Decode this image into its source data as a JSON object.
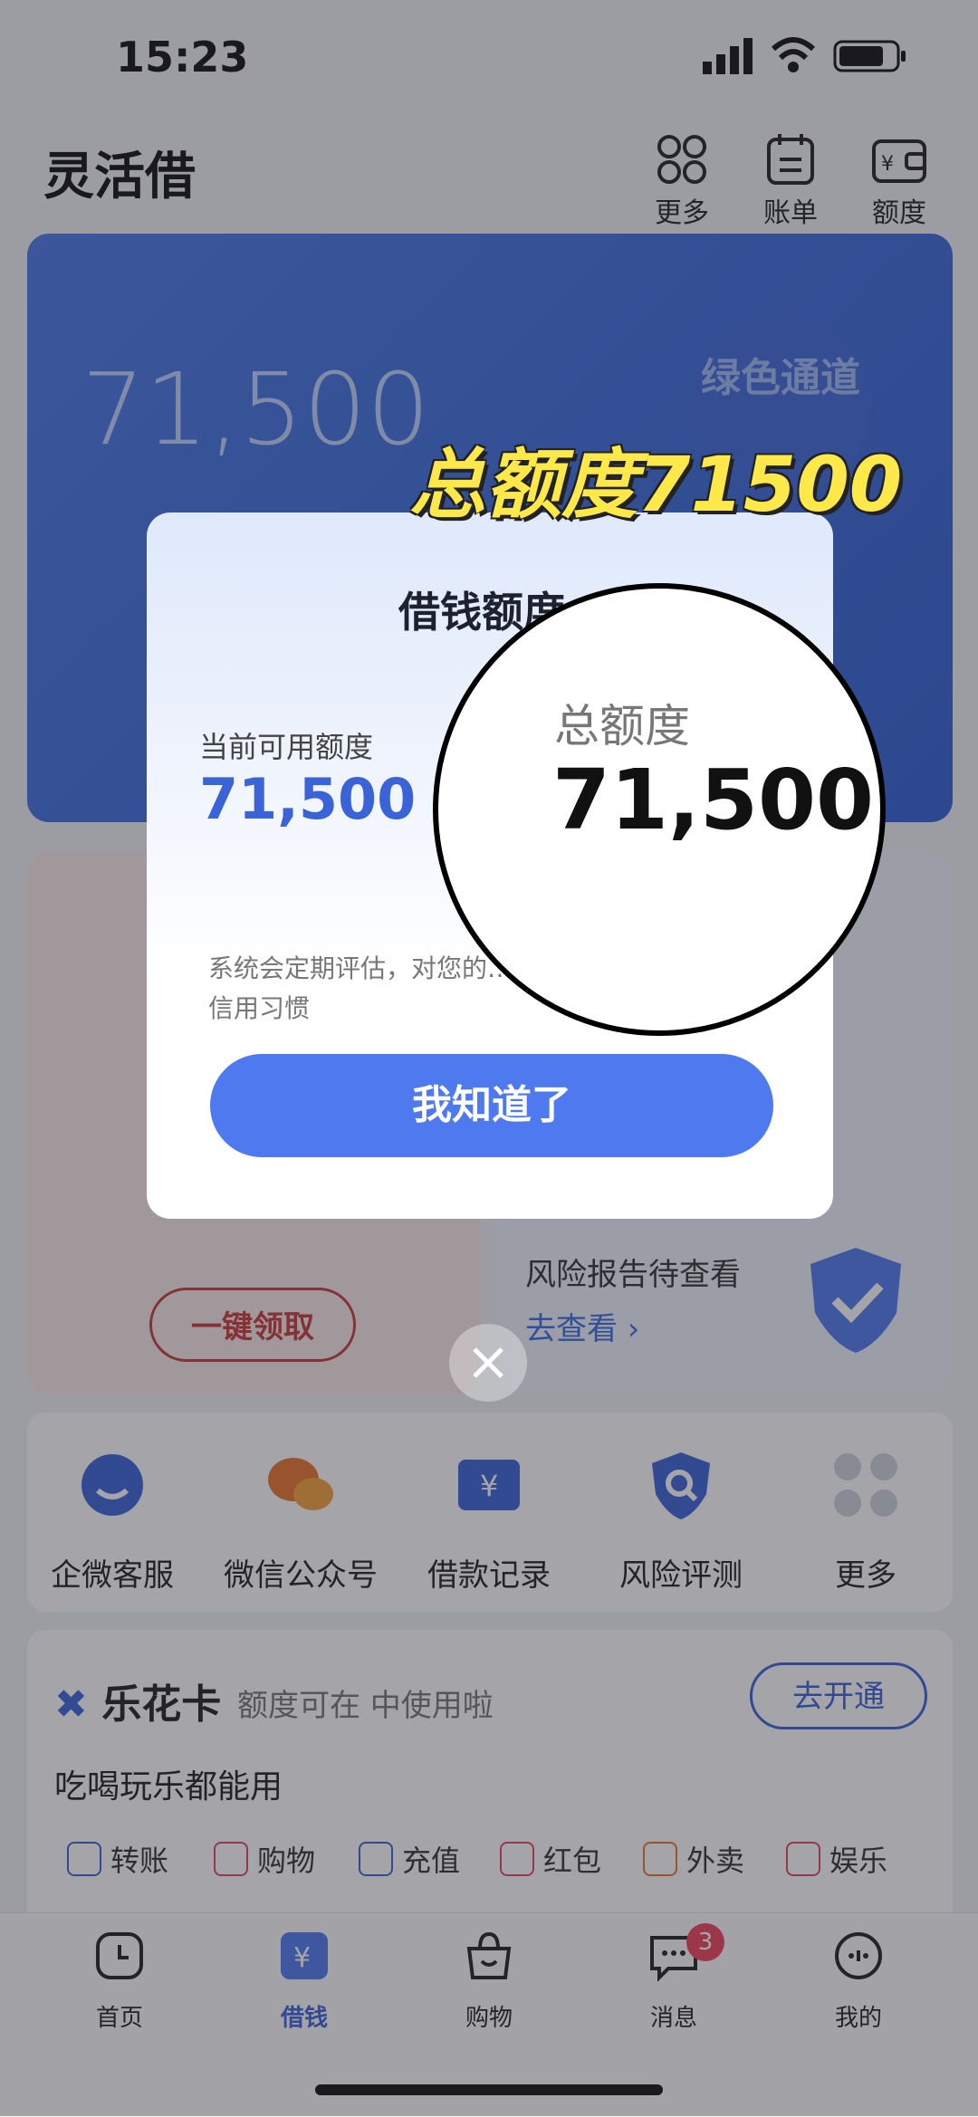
{
  "status": {
    "time": "15:23"
  },
  "header": {
    "title": "灵活借",
    "buttons": [
      {
        "label": "更多"
      },
      {
        "label": "账单"
      },
      {
        "label": "额度"
      }
    ]
  },
  "background_card": {
    "amount": "71,500",
    "badge_text": "绿色通道"
  },
  "risk_panel": {
    "title": "风险报告待查看",
    "link": "去查看 ›"
  },
  "left_panel": {
    "button": "一键领取"
  },
  "quick_actions": [
    {
      "label": "企微客服",
      "icon": "customer-service-icon",
      "color": "#3a63d8"
    },
    {
      "label": "微信公众号",
      "icon": "wechat-icon",
      "color": "#e8742e"
    },
    {
      "label": "借款记录",
      "icon": "loan-record-icon",
      "color": "#3a63d8"
    },
    {
      "label": "风险评测",
      "icon": "shield-search-icon",
      "color": "#3a63d8"
    },
    {
      "label": "更多",
      "icon": "more-grid-icon",
      "color": "#cfd3db"
    }
  ],
  "lehua": {
    "title": "乐花卡",
    "subtitle": "额度可在  中使用啦",
    "open_button": "去开通",
    "tagline": "吃喝玩乐都能用",
    "tags": [
      {
        "label": "转账",
        "color": "#3a63d8"
      },
      {
        "label": "购物",
        "color": "#e0455c"
      },
      {
        "label": "充值",
        "color": "#3a63d8"
      },
      {
        "label": "红包",
        "color": "#e0455c"
      },
      {
        "label": "外卖",
        "color": "#e8742e"
      },
      {
        "label": "娱乐",
        "color": "#e0455c"
      }
    ]
  },
  "tabbar": {
    "tabs": [
      {
        "label": "首页",
        "icon": "home-icon",
        "active": false
      },
      {
        "label": "借钱",
        "icon": "yuan-icon",
        "active": true
      },
      {
        "label": "购物",
        "icon": "shopping-bag-icon",
        "active": false
      },
      {
        "label": "消息",
        "icon": "message-icon",
        "active": false
      },
      {
        "label": "我的",
        "icon": "profile-icon",
        "active": false
      }
    ],
    "message_badge": "3"
  },
  "modal": {
    "title": "借钱额度",
    "current_label": "当前可用额度",
    "current_value": "71,500",
    "note": "系统会定期评估，对您的…时还款并保持良好的信用习惯",
    "ok_button": "我知道了"
  },
  "magnifier": {
    "label": "总额度",
    "value": "71,500"
  },
  "callout": "总额度71500",
  "colors": {
    "accent": "#4f79ee",
    "callout": "#ffe94a"
  }
}
